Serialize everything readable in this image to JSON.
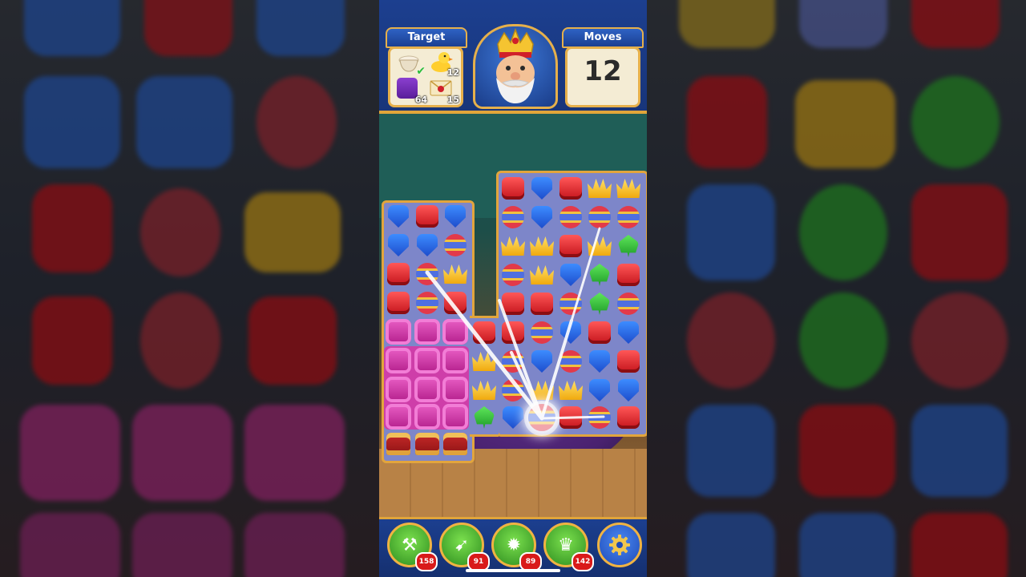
{
  "hud": {
    "target_label": "Target",
    "moves_label": "Moves",
    "moves_value": "12",
    "targets": [
      {
        "icon": "pot-icon",
        "count": "",
        "done": true
      },
      {
        "icon": "duck-icon",
        "count": "12",
        "done": false
      },
      {
        "icon": "purple-tile-icon",
        "count": "64",
        "done": false
      },
      {
        "icon": "envelope-icon",
        "count": "15",
        "done": false
      }
    ]
  },
  "boosters": [
    {
      "name": "hammer-booster",
      "icon": "hammer-icon",
      "glyph": "⚒",
      "count": "158"
    },
    {
      "name": "arrow-booster",
      "icon": "arrow-icon",
      "glyph": "➹",
      "count": "91"
    },
    {
      "name": "cannon-booster",
      "icon": "cannon-icon",
      "glyph": "✹",
      "count": "89"
    },
    {
      "name": "jester-booster",
      "icon": "jester-hat-icon",
      "glyph": "♛",
      "count": "142"
    }
  ],
  "settings_icon": "gear-icon",
  "colors": {
    "hud_blue": "#1c3f8f",
    "gold": "#e6b04b",
    "board": "#7d86c9"
  }
}
